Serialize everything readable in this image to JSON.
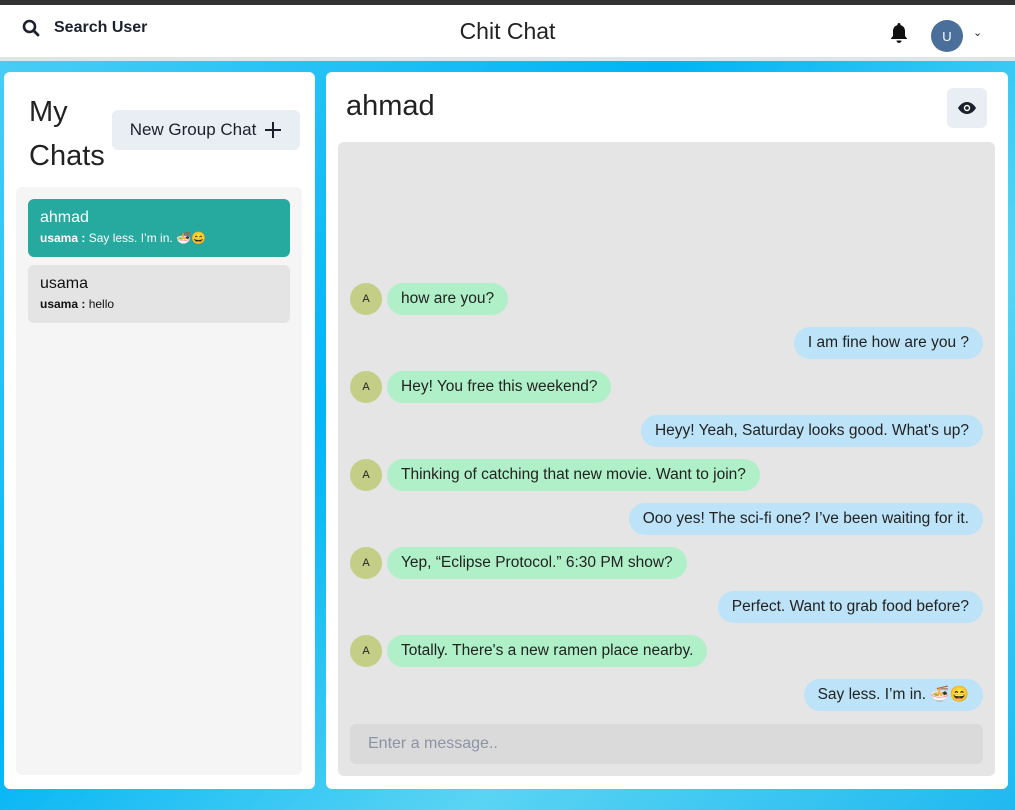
{
  "header": {
    "search_label": "Search User",
    "title": "Chit Chat",
    "user_initial": "U"
  },
  "sidebar": {
    "title_line1": "My",
    "title_line2": "Chats",
    "new_group_label": "New Group Chat",
    "chats": [
      {
        "name": "ahmad",
        "sender": "usama :",
        "preview": "Say less. I’m in. 🍜😄",
        "active": true
      },
      {
        "name": "usama",
        "sender": "usama :",
        "preview": "hello",
        "active": false
      }
    ]
  },
  "chat": {
    "name": "ahmad",
    "avatar_initial": "A",
    "messages": [
      {
        "from": "them",
        "text": "how are you?"
      },
      {
        "from": "me",
        "text": "I am fine how are you ?"
      },
      {
        "from": "them",
        "text": "Hey! You free this weekend?"
      },
      {
        "from": "me",
        "text": "Heyy! Yeah, Saturday looks good. What's up?"
      },
      {
        "from": "them",
        "text": "Thinking of catching that new movie. Want to join?"
      },
      {
        "from": "me",
        "text": "Ooo yes! The sci-fi one? I’ve been waiting for it."
      },
      {
        "from": "them",
        "text": "Yep, “Eclipse Protocol.” 6:30 PM show?"
      },
      {
        "from": "me",
        "text": "Perfect. Want to grab food before?"
      },
      {
        "from": "them",
        "text": "Totally. There's a new ramen place nearby."
      },
      {
        "from": "me",
        "text": "Say less. I’m in. 🍜😄"
      }
    ],
    "input_placeholder": "Enter a message.."
  },
  "colors": {
    "active_chat": "#26a99f",
    "their_bubble": "#b0f0c8",
    "my_bubble": "#bde3f8"
  }
}
